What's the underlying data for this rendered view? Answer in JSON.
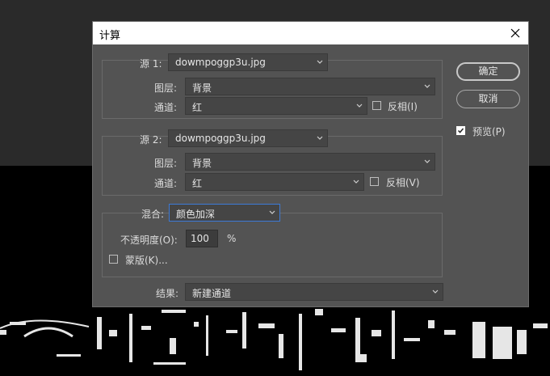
{
  "dialog": {
    "title": "计算",
    "source1": {
      "label": "源 1:",
      "file": "dowmpoggp3u.jpg",
      "layer_label": "图层:",
      "layer": "背景",
      "channel_label": "通道:",
      "channel": "红",
      "invert_label": "反相(I)",
      "invert_checked": false
    },
    "source2": {
      "label": "源 2:",
      "file": "dowmpoggp3u.jpg",
      "layer_label": "图层:",
      "layer": "背景",
      "channel_label": "通道:",
      "channel": "红",
      "invert_label": "反相(V)",
      "invert_checked": false
    },
    "blend": {
      "label": "混合:",
      "mode": "颜色加深",
      "opacity_label": "不透明度(O):",
      "opacity": "100",
      "opacity_unit": "%",
      "mask_label": "蒙版(K)...",
      "mask_checked": false
    },
    "result": {
      "label": "结果:",
      "value": "新建通道"
    },
    "buttons": {
      "ok": "确定",
      "cancel": "取消"
    },
    "preview": {
      "label": "预览(P)",
      "checked": true
    }
  },
  "colors": {
    "dialog_bg": "#535353",
    "titlebar_bg": "#ffffff",
    "focus_border": "#3d7ad6"
  }
}
